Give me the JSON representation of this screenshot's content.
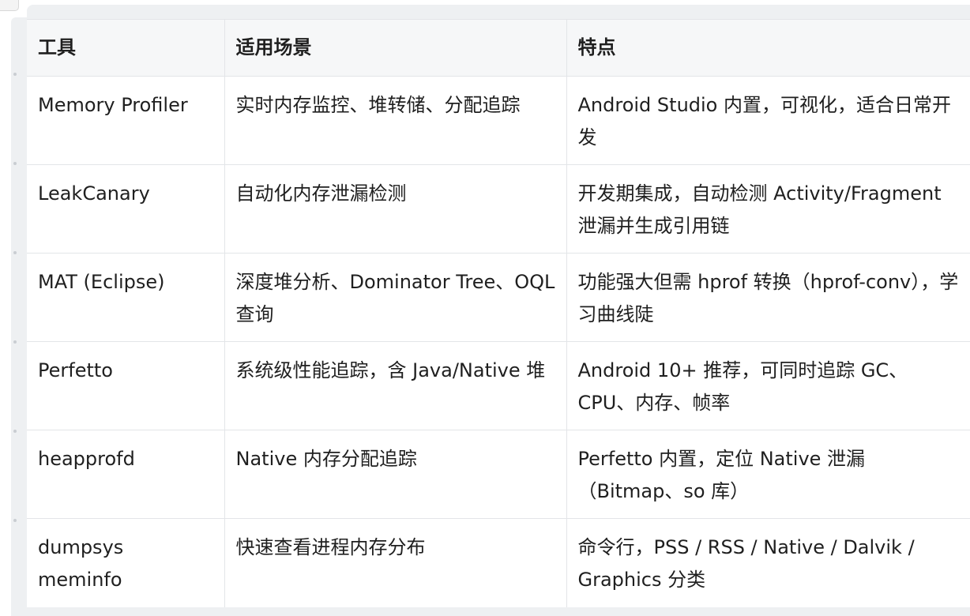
{
  "table": {
    "headers": [
      "工具",
      "适用场景",
      "特点"
    ],
    "rows": [
      [
        "Memory Profiler",
        "实时内存监控、堆转储、分配追踪",
        "Android Studio 内置，可视化，适合日常开发"
      ],
      [
        "LeakCanary",
        "自动化内存泄漏检测",
        "开发期集成，自动检测 Activity/Fragment 泄漏并生成引用链"
      ],
      [
        "MAT (Eclipse)",
        "深度堆分析、Dominator Tree、OQL 查询",
        "功能强大但需 hprof 转换（hprof-conv），学习曲线陡"
      ],
      [
        "Perfetto",
        "系统级性能追踪，含 Java/Native 堆",
        "Android 10+ 推荐，可同时追踪 GC、CPU、内存、帧率"
      ],
      [
        "heapprofd",
        "Native 内存分配追踪",
        "Perfetto 内置，定位 Native 泄漏（Bitmap、so 库）"
      ],
      [
        "dumpsys meminfo",
        "快速查看进程内存分布",
        "命令行，PSS / RSS / Native / Dalvik / Graphics 分类"
      ]
    ]
  }
}
